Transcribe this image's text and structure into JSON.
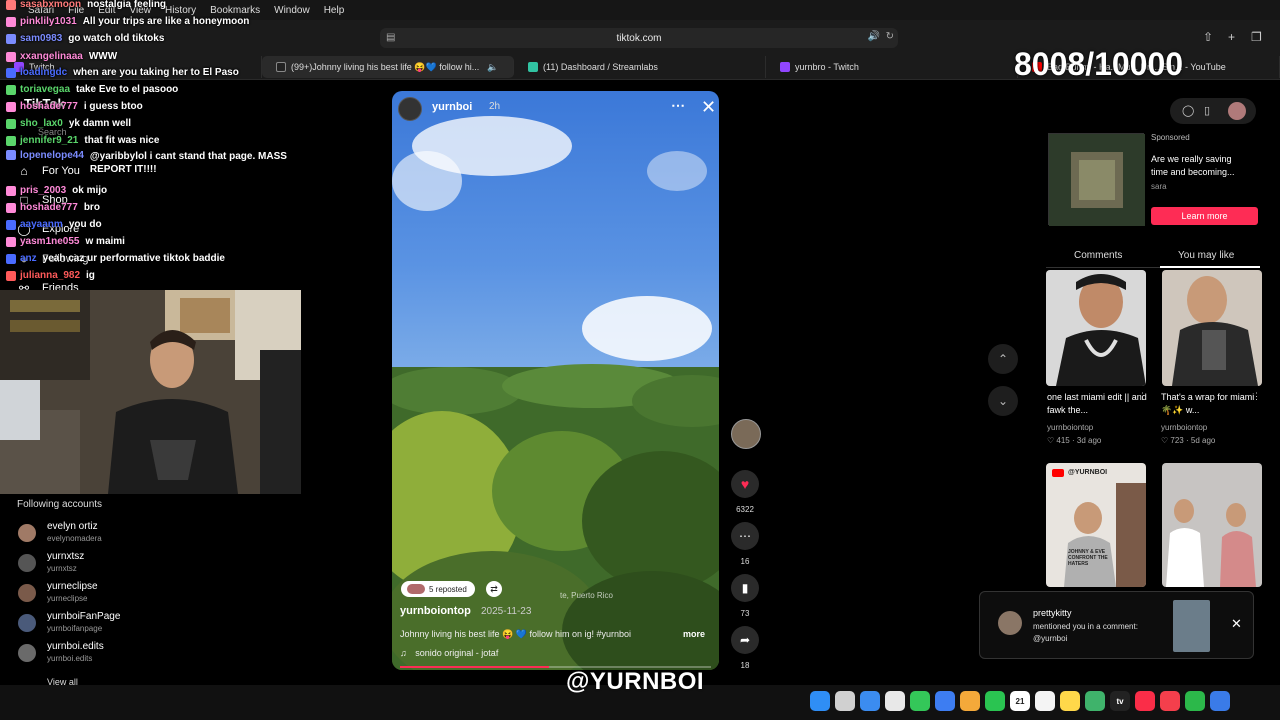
{
  "menubar": {
    "items": [
      "Safari",
      "File",
      "Edit",
      "View",
      "History",
      "Bookmarks",
      "Window",
      "Help"
    ]
  },
  "browser": {
    "url": "tiktok.com",
    "tabs": [
      {
        "label": "Twitch",
        "color": "#9146ff"
      },
      {
        "label": "(99+)Johnny living his best life 😝💙 follow hi...",
        "color": "#222222"
      },
      {
        "label": "(11) Dashboard / Streamlabs",
        "color": "#31c3a2"
      },
      {
        "label": "yurnbro - Twitch",
        "color": "#9146ff"
      },
      {
        "label": "Bad Bunny - Ha.. Mu... Un... Sin... - YouTube",
        "color": "#ff0000"
      }
    ]
  },
  "counter": "8008/10000",
  "tiktok_nav": {
    "logo": "TikTok",
    "search": "Search",
    "items": [
      {
        "label": "For You",
        "icon": "home-icon"
      },
      {
        "label": "Shop",
        "icon": "shop-icon"
      },
      {
        "label": "Explore",
        "icon": "compass-icon"
      },
      {
        "label": "Following",
        "icon": "following-icon"
      },
      {
        "label": "Friends",
        "icon": "friends-icon"
      }
    ]
  },
  "chat": [
    {
      "user": "sasabxmoon",
      "msg": "nostalgia feeling",
      "color": "#ff7a7a"
    },
    {
      "user": "pinklily1031",
      "msg": "All your trips are like a honeymoon",
      "color": "#ff8ad8"
    },
    {
      "user": "sam0983",
      "msg": "go watch old tiktoks",
      "color": "#7b8cff"
    },
    {
      "user": "xxangelinaaa",
      "msg": "WWW",
      "color": "#ff8ad8"
    },
    {
      "user": "loadingdc",
      "msg": "when are you taking her to El Paso",
      "color": "#4a6bff"
    },
    {
      "user": "toriavegaa",
      "msg": "take Eve to el pasooo",
      "color": "#5ad66b"
    },
    {
      "user": "hoshade777",
      "msg": "i guess btoo",
      "color": "#ff8ad8"
    },
    {
      "user": "sho_lax0",
      "msg": "yk damn well",
      "color": "#5ad66b"
    },
    {
      "user": "jennifer9_21",
      "msg": "that fit was nice",
      "color": "#5ad66b"
    },
    {
      "user": "lopenelope44",
      "msg": "@yaribbylol i cant stand that page. MASS REPORT IT!!!!",
      "color": "#7b8cff"
    },
    {
      "user": "pris_2003",
      "msg": "ok mijo",
      "color": "#ff8ad8"
    },
    {
      "user": "hoshade777",
      "msg": "bro",
      "color": "#ff8ad8"
    },
    {
      "user": "aayaanm",
      "msg": "you do",
      "color": "#4a6bff"
    },
    {
      "user": "yasm1ne055",
      "msg": "w maimi",
      "color": "#ff8ad8"
    },
    {
      "user": "anz",
      "msg": "yeah caz ur performative tiktok baddie",
      "color": "#4a6bff"
    },
    {
      "user": "julianna_982",
      "msg": "ig",
      "color": "#ff5a5a"
    }
  ],
  "following": {
    "title": "Following accounts",
    "accounts": [
      {
        "name": "evelyn ortiz",
        "handle": "evelynomadera",
        "color": "#a07a66"
      },
      {
        "name": "yurnxtsz",
        "handle": "yurnxtsz",
        "color": "#555555"
      },
      {
        "name": "yurneclipse",
        "handle": "yurneclipse",
        "color": "#7a5a4a"
      },
      {
        "name": "yurnboiFanPage",
        "handle": "yurnboifanpage",
        "color": "#4a5a7a"
      },
      {
        "name": "yurnboi.edits",
        "handle": "yurnboi.edits",
        "color": "#6a6a6a"
      }
    ],
    "view_all": "View all"
  },
  "video": {
    "author": "yurnboi",
    "time": "2h",
    "repost_text": "5 reposted",
    "location": "te, Puerto Rico",
    "username": "yurnboiontop",
    "date": "2025-11-23",
    "description": "Johnny living his best life 😝 💙 follow him on ig! #yurnboi",
    "more": "more",
    "music": "sonido original - jotaf",
    "progress": 0.48
  },
  "rail": {
    "likes": "6322",
    "comments": "16",
    "saves": "73",
    "shares": "18"
  },
  "sponsored": {
    "label": "Sponsored",
    "text": "Are we really saving time and becoming...",
    "sub": "sara",
    "cta": "Learn more"
  },
  "right_tabs": {
    "comments": "Comments",
    "may_like": "You may like"
  },
  "cards": [
    {
      "title": "one last miami edit || and fawk the...",
      "user": "yurnboiontop",
      "likes": "415",
      "ago": "3d ago"
    },
    {
      "title": "That's a wrap for miami 🌴✨ w...",
      "user": "yurnboiontop",
      "likes": "723",
      "ago": "5d ago"
    }
  ],
  "thumb_label": "@YURNBOI",
  "thumb_caption": "JOHNNY & EVE CONFRONT THE HATERS",
  "notification": {
    "name": "prettykitty",
    "message": "mentioned you in a comment: @yurnboi"
  },
  "handle_overlay": "@YURNBOI",
  "dock_apps": [
    {
      "name": "finder",
      "color": "#2f8ef5",
      "label": ""
    },
    {
      "name": "launchpad",
      "color": "#d0d0d0",
      "label": ""
    },
    {
      "name": "safari",
      "color": "#3b8cf0",
      "label": ""
    },
    {
      "name": "chrome",
      "color": "#e8e8e8",
      "label": ""
    },
    {
      "name": "messages",
      "color": "#34c759",
      "label": ""
    },
    {
      "name": "mail",
      "color": "#3d7df2",
      "label": ""
    },
    {
      "name": "photos",
      "color": "#f4a93a",
      "label": ""
    },
    {
      "name": "facetime",
      "color": "#2ac451",
      "label": ""
    },
    {
      "name": "calendar",
      "color": "#ffffff",
      "label": "21"
    },
    {
      "name": "notes-a",
      "color": "#f4f4f4",
      "label": ""
    },
    {
      "name": "notes",
      "color": "#ffd84a",
      "label": ""
    },
    {
      "name": "maps",
      "color": "#3fb36b",
      "label": ""
    },
    {
      "name": "tv",
      "color": "#222222",
      "label": "tv"
    },
    {
      "name": "music",
      "color": "#fa2d48",
      "label": ""
    },
    {
      "name": "news",
      "color": "#f43f4c",
      "label": ""
    },
    {
      "name": "numbers",
      "color": "#2cb84a",
      "label": ""
    },
    {
      "name": "more",
      "color": "#3a7be8",
      "label": ""
    }
  ]
}
